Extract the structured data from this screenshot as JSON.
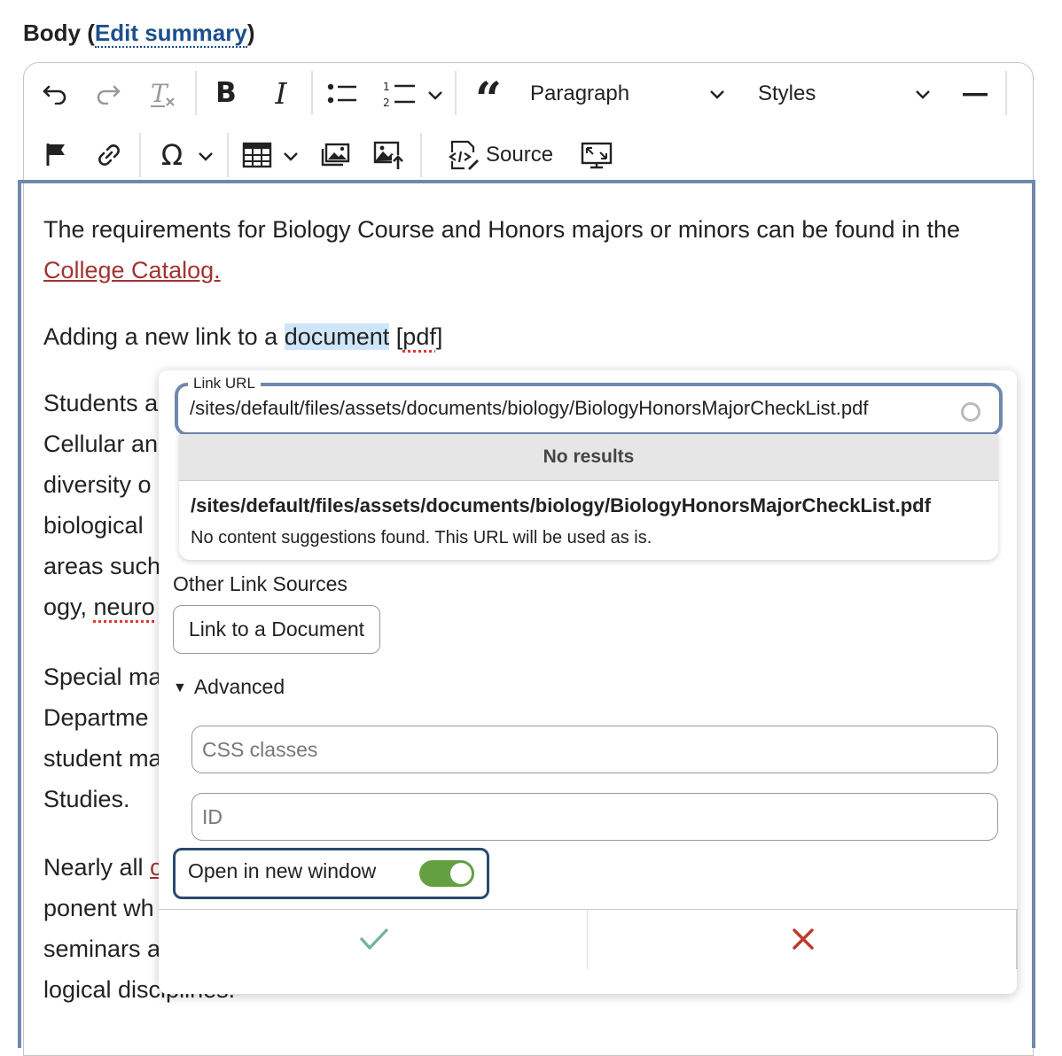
{
  "field": {
    "label_prefix": "Body (",
    "edit_link": "Edit summary",
    "label_suffix": ")"
  },
  "toolbar": {
    "paragraph_label": "Paragraph",
    "styles_label": "Styles",
    "source_label": "Source"
  },
  "content": {
    "p1_text": "The requirements for Biology Course and Honors majors or minors can be found in the",
    "p1_link": "College Catalog.",
    "p2_before": "Adding a new link to a ",
    "p2_highlight": "document",
    "p2_space": " ",
    "p2_bracket_open": "[",
    "p2_pdf": "pdf",
    "p2_bracket_close": "]",
    "p3_lines": [
      "Students a",
      "Cellular an",
      "diversity o",
      "biological",
      "areas such"
    ],
    "p3_last_prefix": "ogy, ",
    "p3_last_word": "neuro",
    "p4_lines": [
      "Special ma",
      "Departme",
      "student ma",
      "Studies."
    ],
    "p5_line1_prefix": "Nearly all ",
    "p5_line1_link": "c",
    "p5_lines": [
      "ponent wh",
      "seminars a",
      "logical disciplines."
    ]
  },
  "link_balloon": {
    "url_label": "Link URL",
    "url_value": "/sites/default/files/assets/documents/biology/BiologyHonorsMajorCheckList.pdf",
    "autocomplete_header": "No results",
    "autocomplete_path": "/sites/default/files/assets/documents/biology/BiologyHonorsMajorCheckList.pdf",
    "autocomplete_message": "No content suggestions found. This URL will be used as is.",
    "other_sources_label": "Other Link Sources",
    "document_button": "Link to a Document",
    "advanced_label": "Advanced",
    "css_placeholder": "CSS classes",
    "id_placeholder": "ID",
    "new_window_label": "Open in new window",
    "new_window_on": true,
    "save_color": "#76b39d",
    "cancel_color": "#c0392b"
  }
}
